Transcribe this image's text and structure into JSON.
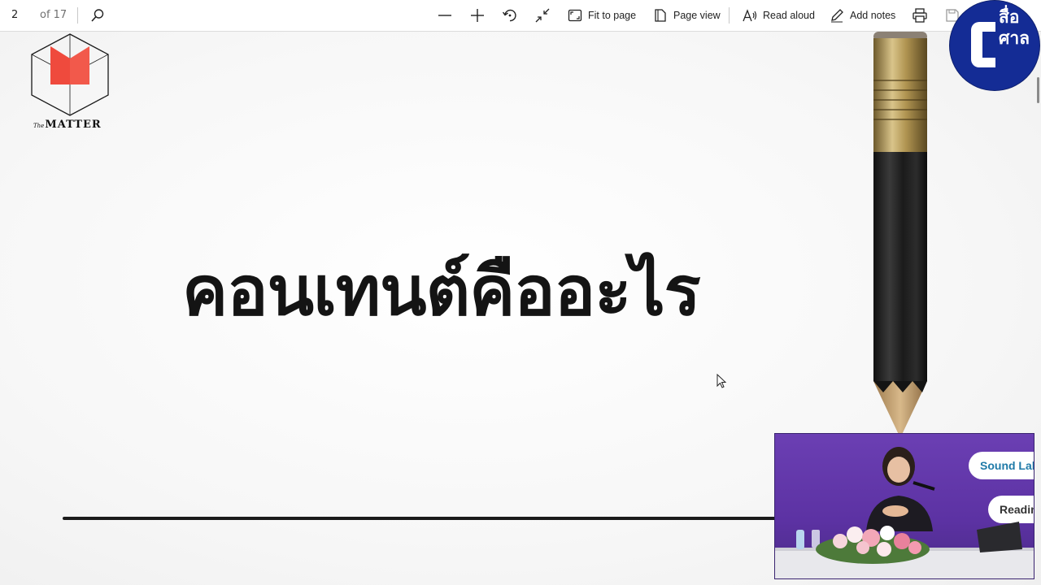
{
  "toolbar": {
    "page_number": "2",
    "page_total": "of 17",
    "fit_to_page": "Fit to page",
    "page_view": "Page view",
    "read_aloud": "Read aloud",
    "add_notes": "Add notes"
  },
  "slide": {
    "logo_the": "The",
    "logo_name": "MATTER",
    "headline": "คอนเทนต์คืออะไร"
  },
  "channel": {
    "line1": "สื่อ",
    "line2": "ศาล"
  },
  "video": {
    "bubble1": "Sound Lab",
    "bubble2": "Reading"
  },
  "colors": {
    "logo_red": "#f2594b",
    "channel_blue": "#142c95",
    "video_purple": "#5c32a3"
  }
}
